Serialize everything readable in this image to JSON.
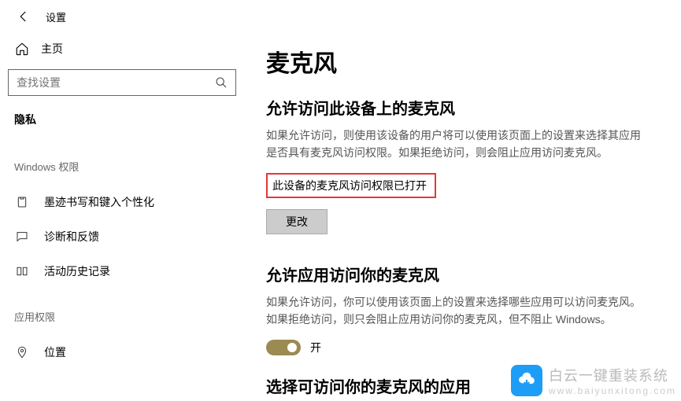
{
  "header": {
    "title": "设置"
  },
  "sidebar": {
    "home": "主页",
    "search_placeholder": "查找设置",
    "section": "隐私",
    "group_windows": "Windows 权限",
    "items": [
      {
        "label": "墨迹书写和键入个性化"
      },
      {
        "label": "诊断和反馈"
      },
      {
        "label": "活动历史记录"
      }
    ],
    "group_app": "应用权限",
    "app_items": [
      {
        "label": "位置"
      }
    ]
  },
  "content": {
    "title": "麦克风",
    "section1": {
      "heading": "允许访问此设备上的麦克风",
      "body": "如果允许访问，则使用该设备的用户将可以使用该页面上的设置来选择其应用是否具有麦克风访问权限。如果拒绝访问，则会阻止应用访问麦克风。",
      "status": "此设备的麦克风访问权限已打开",
      "button": "更改"
    },
    "section2": {
      "heading": "允许应用访问你的麦克风",
      "body": "如果允许访问，你可以使用该页面上的设置来选择哪些应用可以访问麦克风。如果拒绝访问，则只会阻止应用访问你的麦克风，但不阻止 Windows。",
      "toggle_label": "开"
    },
    "section3": {
      "heading": "选择可访问你的麦克风的应用"
    }
  },
  "watermark": {
    "line1": "白云一键重装系统",
    "line2": "www.baiyunxitong.com"
  }
}
